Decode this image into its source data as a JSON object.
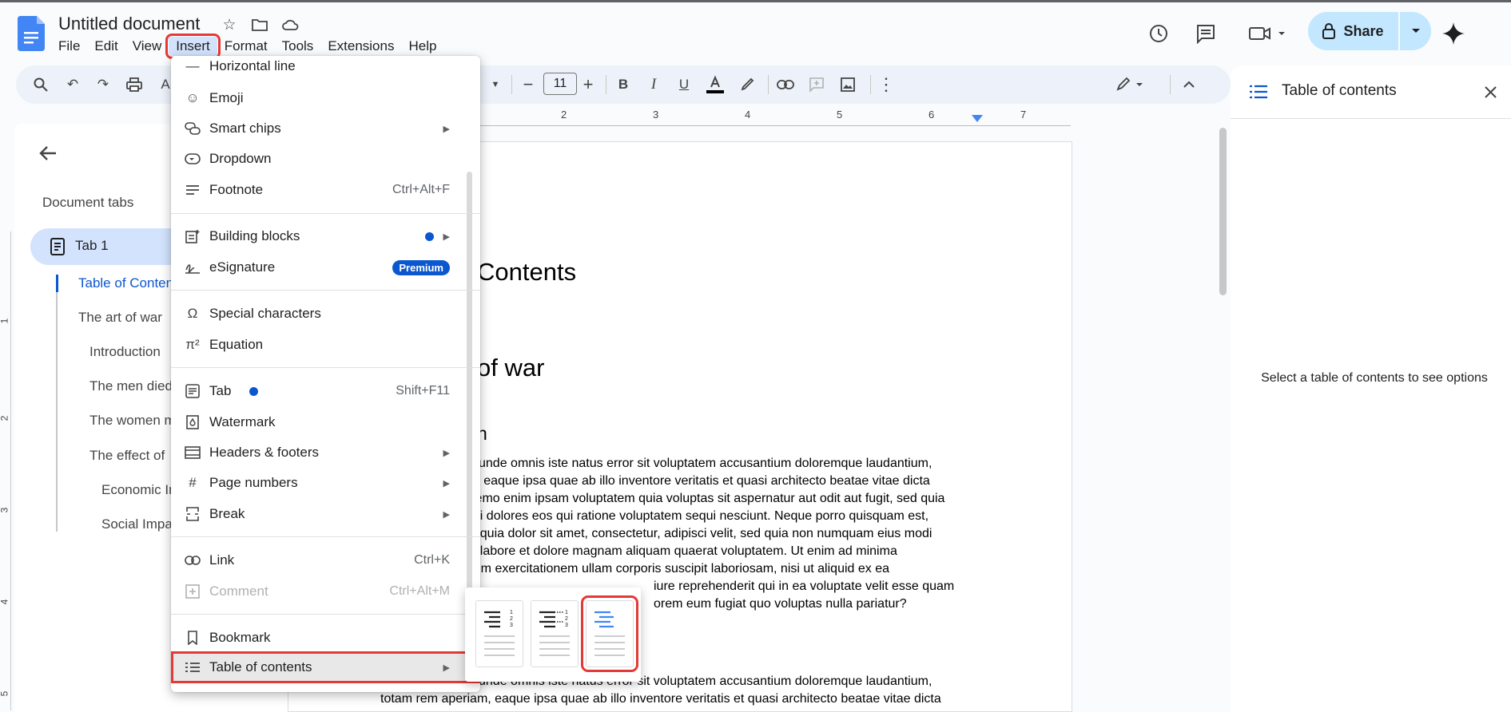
{
  "doc": {
    "title": "Untitled document"
  },
  "menubar": [
    "File",
    "Edit",
    "View",
    "Insert",
    "Format",
    "Tools",
    "Extensions",
    "Help"
  ],
  "header": {
    "share_label": "Share"
  },
  "toolbar": {
    "font_size": "11"
  },
  "ruler": {
    "labels": [
      "2",
      "3",
      "4",
      "5",
      "6",
      "7"
    ]
  },
  "vruler": {
    "labels": [
      "1",
      "2",
      "3",
      "4",
      "5"
    ]
  },
  "sidebar": {
    "title": "Document tabs",
    "tab1": "Tab 1",
    "outline": [
      "Table of Contents",
      "The art of war",
      "Introduction",
      "The men died",
      "The women m",
      "The effect of",
      "Economic Im",
      "Social Impa"
    ]
  },
  "document": {
    "h1_toc": "Contents",
    "h1_war": "of war",
    "h2_intro": "n",
    "para1": [
      "is unde omnis iste natus error sit voluptatem accusantium doloremque laudantium,",
      "m, eaque ipsa quae ab illo inventore veritatis et quasi architecto beatae vitae dicta",
      "Nemo enim ipsam voluptatem quia voluptas sit aspernatur aut odit aut fugit, sed quia",
      "gni dolores eos qui ratione voluptatem sequi nesciunt. Neque porro quisquam est,",
      "m quia dolor sit amet, consectetur, adipisci velit, sed quia non numquam eius modi",
      "ut labore et dolore magnam aliquam quaerat voluptatem. Ut enim ad minima",
      "trum exercitationem ullam corporis suscipit laboriosam, nisi ut aliquid ex ea",
      "iure reprehenderit qui in ea voluptate velit esse quam",
      "orem eum fugiat quo voluptas nulla pariatur?"
    ],
    "para2": [
      "is unde omnis iste natus error sit voluptatem accusantium doloremque laudantium,",
      "totam rem aperiam, eaque ipsa quae ab illo inventore veritatis et quasi architecto beatae vitae dicta"
    ]
  },
  "insert_menu": {
    "horizontal_line": "Horizontal line",
    "emoji": "Emoji",
    "smart_chips": "Smart chips",
    "dropdown": "Dropdown",
    "footnote": "Footnote",
    "footnote_sc": "Ctrl+Alt+F",
    "building_blocks": "Building blocks",
    "esignature": "eSignature",
    "premium": "Premium",
    "special_characters": "Special characters",
    "equation": "Equation",
    "tab": "Tab",
    "tab_sc": "Shift+F11",
    "watermark": "Watermark",
    "headers_footers": "Headers & footers",
    "page_numbers": "Page numbers",
    "break": "Break",
    "link": "Link",
    "link_sc": "Ctrl+K",
    "comment": "Comment",
    "comment_sc": "Ctrl+Alt+M",
    "bookmark": "Bookmark",
    "table_of_contents": "Table of contents"
  },
  "toc_panel": {
    "title": "Table of contents",
    "message": "Select a table of contents to see options"
  },
  "colors": {
    "accent": "#0b57d0",
    "highlight": "#e53935",
    "share_bg": "#c2e7ff"
  }
}
